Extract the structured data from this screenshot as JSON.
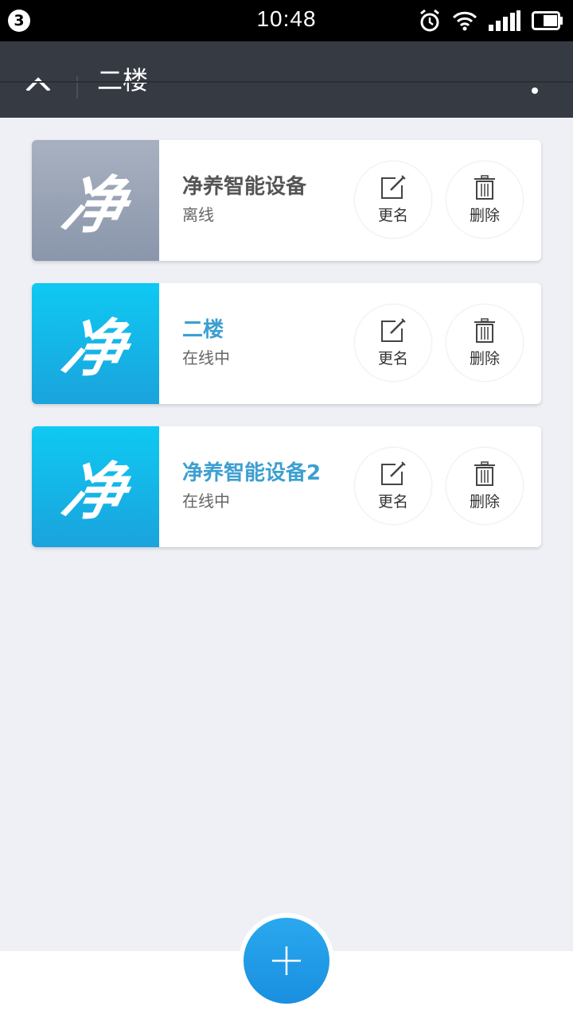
{
  "status_bar": {
    "notification_count": "3",
    "time": "10:48",
    "icons": [
      "alarm-icon",
      "wifi-icon",
      "signal-icon",
      "battery-icon"
    ]
  },
  "app_bar": {
    "title": "二楼",
    "icons": [
      "back-icon",
      "more-icon"
    ],
    "background": "#363b43"
  },
  "devices": [
    {
      "name": "净养智能设备",
      "status": "离线",
      "logo": "净",
      "online": false
    },
    {
      "name": "二楼",
      "status": "在线中",
      "logo": "净",
      "online": true
    },
    {
      "name": "净养智能设备2",
      "status": "在线中",
      "logo": "净",
      "online": true
    }
  ],
  "actions": {
    "rename_label": "更名",
    "delete_label": "删除"
  },
  "fab": {
    "icon": "plus-icon",
    "color": "#1f9be6"
  },
  "colors": {
    "online_name": "#3d9fd0",
    "offline_name": "#555555",
    "online_thumb": "#15b6ea",
    "offline_thumb": "#98a3b6",
    "page_bg": "#eef0f5"
  }
}
